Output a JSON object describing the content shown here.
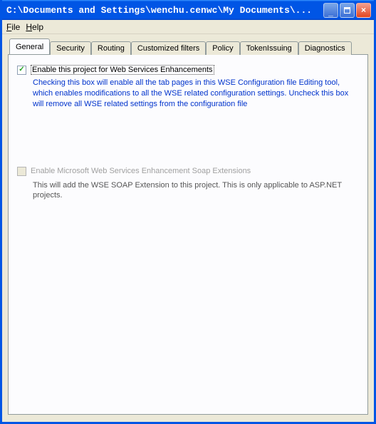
{
  "window": {
    "title": "C:\\Documents and Settings\\wenchu.cenwc\\My Documents\\..."
  },
  "menu": {
    "file": "File",
    "help": "Help"
  },
  "tabs": {
    "items": [
      "General",
      "Security",
      "Routing",
      "Customized filters",
      "Policy",
      "TokenIssuing",
      "Diagnostics"
    ]
  },
  "general": {
    "enable_wse_label": "Enable this project for Web Services Enhancements",
    "enable_wse_checked": "✓",
    "enable_wse_desc": "Checking this box will enable all the tab pages in this WSE Configuration file Editing tool, which enables modifications to all the WSE related configuration settings. Uncheck this box will remove all WSE related settings from the configuration file",
    "soap_ext_label": "Enable Microsoft Web Services Enhancement Soap Extensions",
    "soap_ext_desc": "This will add the WSE SOAP Extension to this project. This is only applicable to ASP.NET projects."
  }
}
